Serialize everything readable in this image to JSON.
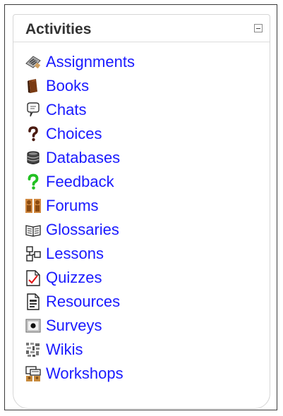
{
  "block": {
    "title": "Activities",
    "collapse_icon": "minus-box-icon"
  },
  "link_color": "#1a1aff",
  "items": [
    {
      "label": "Assignments",
      "icon": "assignment-icon"
    },
    {
      "label": "Books",
      "icon": "book-icon"
    },
    {
      "label": "Chats",
      "icon": "chat-bubble-icon"
    },
    {
      "label": "Choices",
      "icon": "question-mark-icon"
    },
    {
      "label": "Databases",
      "icon": "database-icon"
    },
    {
      "label": "Feedback",
      "icon": "green-question-mark-icon"
    },
    {
      "label": "Forums",
      "icon": "forum-people-icon"
    },
    {
      "label": "Glossaries",
      "icon": "glossary-book-icon"
    },
    {
      "label": "Lessons",
      "icon": "lesson-flowchart-icon"
    },
    {
      "label": "Quizzes",
      "icon": "quiz-checkmark-icon"
    },
    {
      "label": "Resources",
      "icon": "resource-document-icon"
    },
    {
      "label": "Surveys",
      "icon": "survey-icon"
    },
    {
      "label": "Wikis",
      "icon": "wiki-icon"
    },
    {
      "label": "Workshops",
      "icon": "workshop-icon"
    }
  ]
}
